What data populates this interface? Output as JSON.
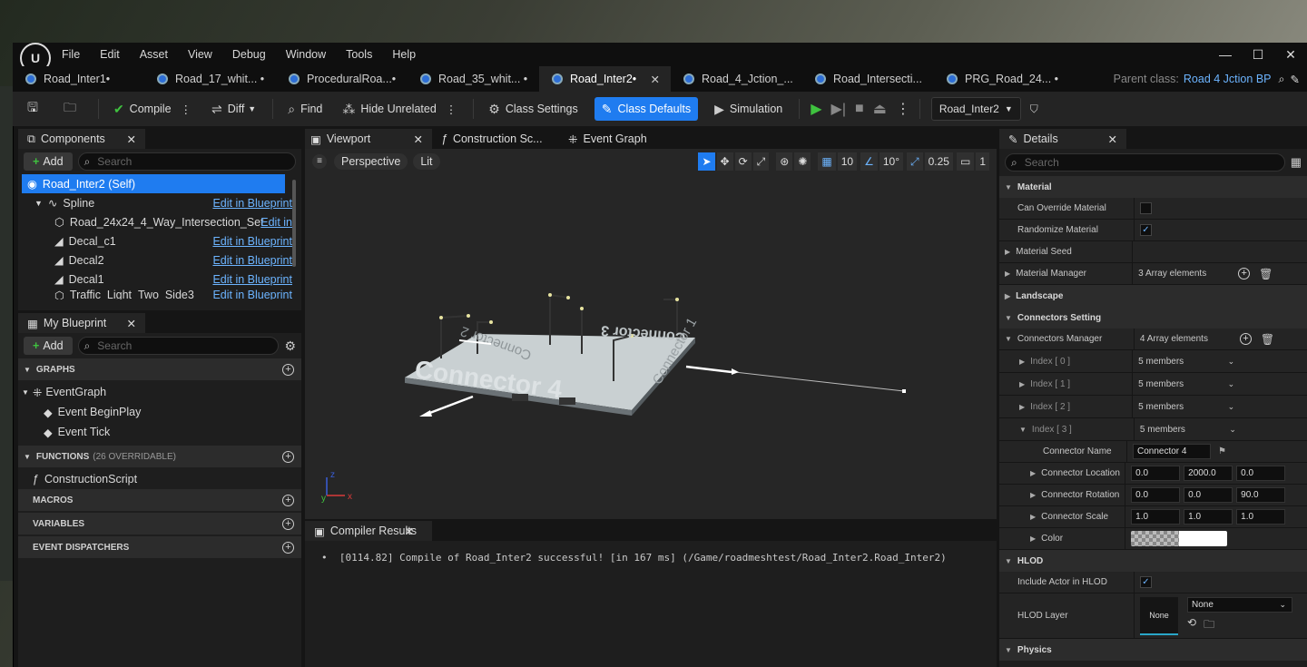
{
  "menu": {
    "items": [
      "File",
      "Edit",
      "Asset",
      "View",
      "Debug",
      "Window",
      "Tools",
      "Help"
    ]
  },
  "tabs": [
    {
      "label": "Road_Inter1•"
    },
    {
      "label": "Road_17_whit... •"
    },
    {
      "label": "ProceduralRoa...•"
    },
    {
      "label": "Road_35_whit... •"
    },
    {
      "label": "Road_Inter2•",
      "active": true
    },
    {
      "label": "Road_4_Jction_..."
    },
    {
      "label": "Road_Intersecti..."
    },
    {
      "label": "PRG_Road_24... •"
    }
  ],
  "parent": {
    "label": "Parent class:",
    "value": "Road 4 Jction BP"
  },
  "toolbar": {
    "compile": "Compile",
    "diff": "Diff",
    "find": "Find",
    "hide_unrelated": "Hide Unrelated",
    "class_settings": "Class Settings",
    "class_defaults": "Class Defaults",
    "simulation": "Simulation",
    "debug_object": "Road_Inter2"
  },
  "components": {
    "title": "Components",
    "add": "Add",
    "search_placeholder": "Search",
    "items": [
      {
        "label": "Road_Inter2 (Self)",
        "link": ""
      },
      {
        "label": "Spline",
        "link": "Edit in Blueprint"
      },
      {
        "label": "Road_24x24_4_Way_Intersection_Set",
        "link": "Edit in"
      },
      {
        "label": "Decal_c1",
        "link": "Edit in Blueprint"
      },
      {
        "label": "Decal2",
        "link": "Edit in Blueprint"
      },
      {
        "label": "Decal1",
        "link": "Edit in Blueprint"
      },
      {
        "label": "Traffic_Light_Two_Side3",
        "link": "Edit in Blueprint"
      }
    ]
  },
  "my_blueprint": {
    "title": "My Blueprint",
    "add": "Add",
    "search_placeholder": "Search",
    "graphs": "GRAPHS",
    "event_graph": "EventGraph",
    "begin_play": "Event BeginPlay",
    "tick": "Event Tick",
    "functions": "FUNCTIONS",
    "functions_note": "(26 OVERRIDABLE)",
    "construction_script": "ConstructionScript",
    "macros": "MACROS",
    "variables": "VARIABLES",
    "dispatchers": "EVENT DISPATCHERS"
  },
  "center_tabs": {
    "viewport": "Viewport",
    "construction": "Construction Sc...",
    "event_graph": "Event Graph"
  },
  "viewport": {
    "perspective": "Perspective",
    "lit": "Lit",
    "grid": "10",
    "angle": "10°",
    "scale": "0.25",
    "camera": "1",
    "labels": [
      "Connector 4",
      "Connector 3",
      "Connector 2",
      "Connector 1"
    ]
  },
  "compiler": {
    "title": "Compiler Results",
    "message": "[0114.82] Compile of Road_Inter2 successful! [in 167 ms] (/Game/roadmeshtest/Road_Inter2.Road_Inter2)"
  },
  "details": {
    "title": "Details",
    "search_placeholder": "Search",
    "material": "Material",
    "can_override": "Can Override Material",
    "randomize": "Randomize Material",
    "material_seed": "Material Seed",
    "material_manager": "Material Manager",
    "mm_value": "3 Array elements",
    "landscape": "Landscape",
    "connectors_setting": "Connectors Setting",
    "connectors_manager": "Connectors Manager",
    "cm_value": "4 Array elements",
    "indices": [
      {
        "label": "Index [ 0 ]",
        "value": "5 members"
      },
      {
        "label": "Index [ 1 ]",
        "value": "5 members"
      },
      {
        "label": "Index [ 2 ]",
        "value": "5 members"
      },
      {
        "label": "Index [ 3 ]",
        "value": "5 members"
      }
    ],
    "connector_name_label": "Connector Name",
    "connector_name": "Connector 4",
    "location_label": "Connector Location",
    "location": [
      "0.0",
      "2000.0",
      "0.0"
    ],
    "rotation_label": "Connector Rotation",
    "rotation": [
      "0.0",
      "0.0",
      "90.0"
    ],
    "scale_label": "Connector Scale",
    "scale": [
      "1.0",
      "1.0",
      "1.0"
    ],
    "color_label": "Color",
    "hlod": "HLOD",
    "include_hlod": "Include Actor in HLOD",
    "hlod_layer": "HLOD Layer",
    "none_thumb": "None",
    "none_dd": "None",
    "physics": "Physics"
  },
  "colors": {
    "accent": "#1f7cf0",
    "link": "#6cb4ff",
    "play": "#3fc23f"
  }
}
